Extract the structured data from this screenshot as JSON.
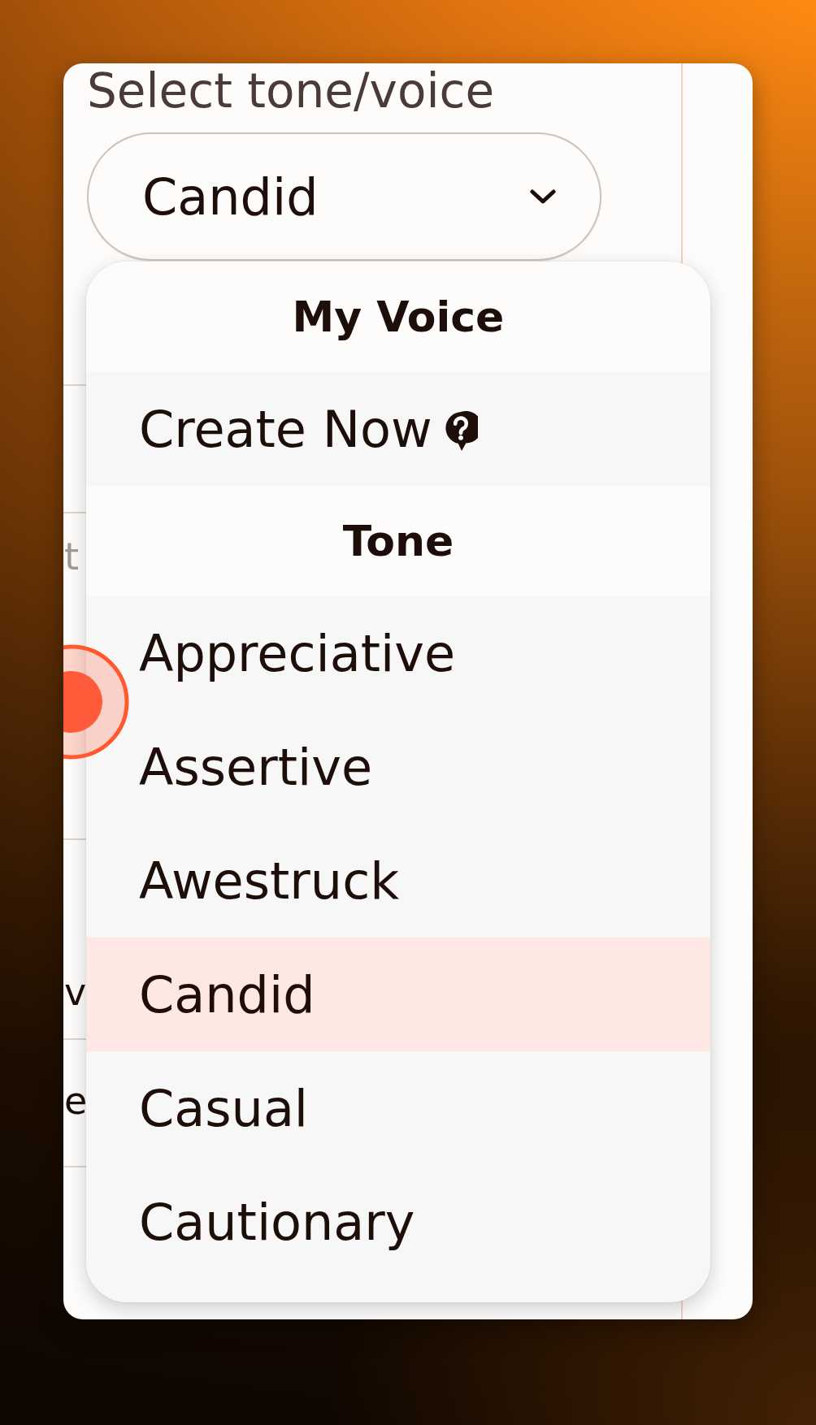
{
  "field": {
    "label": "Select tone/voice",
    "value": "Candid"
  },
  "menu": {
    "sections": [
      {
        "heading": "My Voice",
        "items": [
          {
            "label": "Create Now",
            "kind": "help",
            "selected": false
          }
        ]
      },
      {
        "heading": "Tone",
        "items": [
          {
            "label": "Appreciative",
            "kind": "option",
            "selected": false
          },
          {
            "label": "Assertive",
            "kind": "option",
            "selected": false
          },
          {
            "label": "Awestruck",
            "kind": "option",
            "selected": false
          },
          {
            "label": "Candid",
            "kind": "option",
            "selected": true
          },
          {
            "label": "Casual",
            "kind": "option",
            "selected": false
          },
          {
            "label": "Cautionary",
            "kind": "option",
            "selected": false
          }
        ]
      }
    ]
  },
  "background_fields": [
    {
      "kind": "placeholder",
      "text": "t"
    },
    {
      "kind": "value",
      "text": "v"
    },
    {
      "kind": "value",
      "text": "e"
    }
  ]
}
